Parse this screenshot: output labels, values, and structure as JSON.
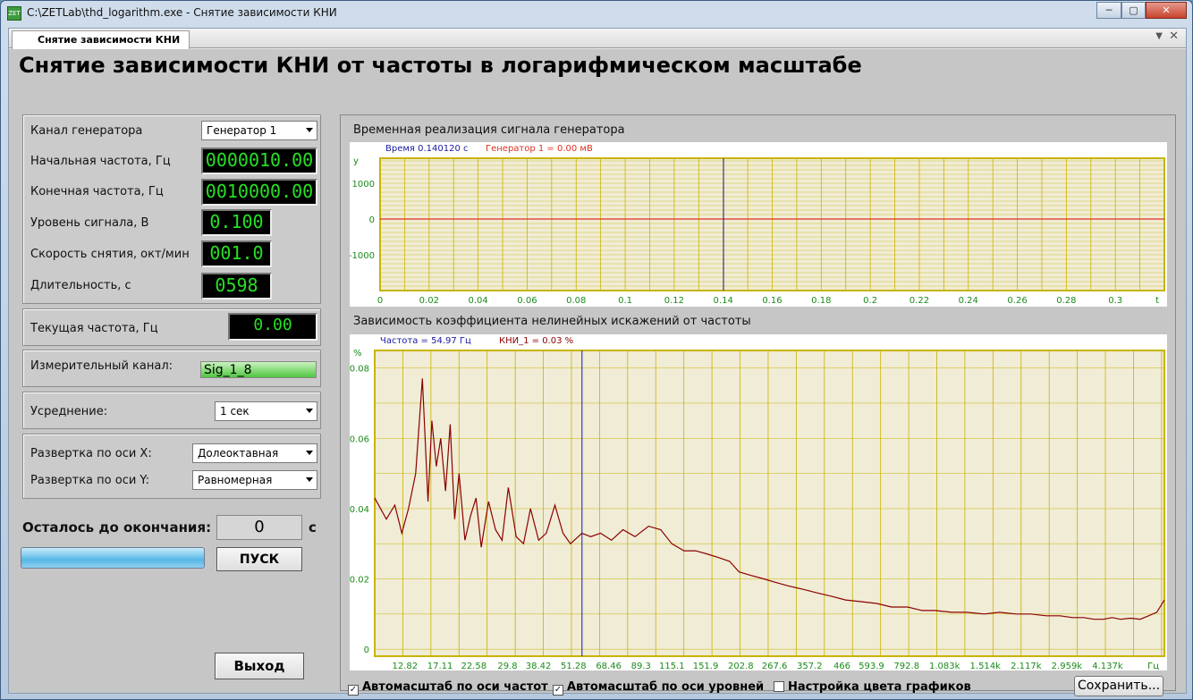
{
  "window": {
    "title": "C:\\ZETLab\\thd_logarithm.exe - Снятие зависимости КНИ",
    "icon": "zet-app-icon",
    "buttons": {
      "minimize": "─",
      "maximize": "▢",
      "close": "✕"
    }
  },
  "tab": {
    "label": "Снятие зависимости КНИ",
    "menu_arrow": "▼",
    "close": "✕"
  },
  "heading": "Снятие зависимости КНИ от частоты в логарифмическом масштабе",
  "settings": {
    "generator_channel": {
      "label": "Канал генератора",
      "value": "Генератор 1"
    },
    "start_freq": {
      "label": "Начальная частота, Гц",
      "value": "0000010.00"
    },
    "end_freq": {
      "label": "Конечная частота, Гц",
      "value": "0010000.00"
    },
    "signal_level": {
      "label": "Уровень сигнала, В",
      "value": "0.100"
    },
    "sweep_rate": {
      "label": "Скорость снятия, окт/мин",
      "value": "001.0"
    },
    "duration": {
      "label": "Длительность, с",
      "value": "0598"
    }
  },
  "current_freq": {
    "label": "Текущая частота, Гц",
    "value": "0.00"
  },
  "measure_channel": {
    "label": "Измерительный канал:",
    "value": "Sig_1_8"
  },
  "averaging": {
    "label": "Усреднение:",
    "value": "1 сек"
  },
  "axis_sweep": {
    "x": {
      "label": "Развертка по оси X:",
      "value": "Долеоктавная"
    },
    "y": {
      "label": "Развертка по оси Y:",
      "value": "Равномерная"
    }
  },
  "remaining": {
    "label": "Осталось до окончания:",
    "value": "0",
    "unit": "с",
    "progress": 1.0
  },
  "buttons": {
    "start": "ПУСК",
    "exit": "Выход",
    "save": "Сохранить..."
  },
  "options": {
    "autoscale_freq": {
      "label": "Автомасштаб по оси частот",
      "checked": true,
      "mark": "✓"
    },
    "autoscale_level": {
      "label": "Автомасштаб по оси уровней",
      "checked": true,
      "mark": "✓"
    },
    "graph_colors": {
      "label": "Настройка цвета графиков",
      "checked": false,
      "mark": ""
    }
  },
  "colors": {
    "plot_bg": "#f0ecd6",
    "grid": "#c8b400",
    "signal": "#e03020",
    "thd": "#8b0000",
    "cursor": "#1a1aa0",
    "tick_label": "#1a8a1a"
  },
  "chart_data": [
    {
      "type": "line",
      "title": "Временная реализация сигнала генератора",
      "cursor_readout": "Время 0.140120 с",
      "series_readout": "Генератор 1 = 0.00 мВ",
      "xlabel": "t",
      "ylabel": "y",
      "x_ticks": [
        "0",
        "0.02",
        "0.04",
        "0.06",
        "0.08",
        "0.1",
        "0.12",
        "0.14",
        "0.16",
        "0.18",
        "0.2",
        "0.22",
        "0.24",
        "0.26",
        "0.28",
        "0.3"
      ],
      "y_ticks": [
        "1000",
        "0",
        "-1000"
      ],
      "xlim": [
        0,
        0.32
      ],
      "ylim": [
        -2000,
        1700
      ],
      "cursor_x": 0.14012,
      "series": [
        {
          "name": "Генератор 1",
          "x": [
            0,
            0.32
          ],
          "y": [
            0,
            0
          ]
        }
      ],
      "grid": true
    },
    {
      "type": "line",
      "title": "Зависимость коэффициента нелинейных искажений от частоты",
      "cursor_readout": "Частота = 54.97 Гц",
      "series_readout": "КНИ_1 = 0.03 %",
      "xlabel": "Гц",
      "ylabel": "%",
      "x_ticks": [
        "12.82",
        "17.11",
        "22.58",
        "29.8",
        "38.42",
        "51.28",
        "68.46",
        "89.3",
        "115.1",
        "151.9",
        "202.8",
        "267.6",
        "357.2",
        "466",
        "593.9",
        "792.8",
        "1.083k",
        "1.514k",
        "2.117k",
        "2.959k",
        "4.137k"
      ],
      "y_ticks": [
        "0.08",
        "0.06",
        "0.04",
        "0.02",
        "0"
      ],
      "xlim": [
        10,
        6600
      ],
      "x_scale": "log",
      "ylim": [
        -0.002,
        0.085
      ],
      "cursor_x": 54.97,
      "series": [
        {
          "name": "КНИ_1",
          "x": [
            10,
            11,
            11.8,
            12.5,
            13.2,
            14,
            14.8,
            15.5,
            16,
            16.6,
            17.2,
            17.9,
            18.6,
            19.3,
            20,
            21,
            22,
            23,
            24,
            25.5,
            27,
            28.5,
            30,
            32,
            34,
            36,
            38.5,
            41,
            44,
            47,
            50,
            54.97,
            59,
            64,
            70,
            77,
            85,
            95,
            105,
            115,
            127,
            140,
            155,
            170,
            185,
            200,
            220,
            245,
            270,
            300,
            340,
            380,
            430,
            480,
            550,
            620,
            700,
            800,
            900,
            1000,
            1150,
            1300,
            1500,
            1700,
            1950,
            2200,
            2500,
            2800,
            3100,
            3400,
            3700,
            4000,
            4300,
            4600,
            5000,
            5400,
            5800,
            6200,
            6600
          ],
          "y": [
            0.043,
            0.037,
            0.041,
            0.033,
            0.04,
            0.05,
            0.077,
            0.042,
            0.065,
            0.052,
            0.06,
            0.045,
            0.064,
            0.037,
            0.05,
            0.031,
            0.038,
            0.043,
            0.029,
            0.042,
            0.034,
            0.031,
            0.046,
            0.032,
            0.03,
            0.04,
            0.031,
            0.033,
            0.041,
            0.033,
            0.03,
            0.033,
            0.032,
            0.033,
            0.031,
            0.034,
            0.032,
            0.035,
            0.034,
            0.03,
            0.028,
            0.028,
            0.027,
            0.026,
            0.025,
            0.022,
            0.021,
            0.02,
            0.019,
            0.018,
            0.017,
            0.016,
            0.015,
            0.014,
            0.0135,
            0.013,
            0.012,
            0.012,
            0.011,
            0.011,
            0.0105,
            0.0105,
            0.01,
            0.0105,
            0.01,
            0.01,
            0.0095,
            0.0095,
            0.009,
            0.009,
            0.0085,
            0.0085,
            0.009,
            0.0085,
            0.0088,
            0.0085,
            0.0095,
            0.0105,
            0.014
          ]
        }
      ],
      "grid": true
    }
  ]
}
